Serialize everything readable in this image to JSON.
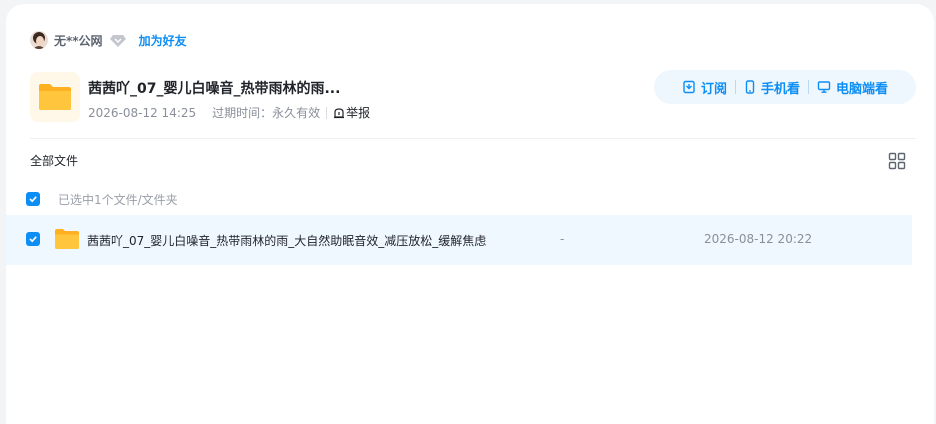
{
  "sharer": {
    "name": "无**公网",
    "add_friend_label": "加为好友"
  },
  "share": {
    "title": "茜茜吖_07_婴儿白噪音_热带雨林的雨...",
    "date": "2026-08-12 14:25",
    "expire_label": "过期时间：",
    "expire_value": "永久有效",
    "report_label": "举报"
  },
  "actions": {
    "subscribe": "订阅",
    "mobile": "手机看",
    "desktop": "电脑端看"
  },
  "list": {
    "breadcrumb": "全部文件",
    "selected_text": "已选中1个文件/文件夹",
    "rows": [
      {
        "name": "茜茜吖_07_婴儿白噪音_热带雨林的雨_大自然助眠音效_减压放松_缓解焦虑",
        "size": "-",
        "date": "2026-08-12 20:22"
      }
    ]
  },
  "colors": {
    "accent": "#0d8ef5",
    "row_highlight": "#f0f8ff",
    "folder": "#ffc53d"
  },
  "icons": {
    "avatar": "avatar-photo",
    "vip": "diamond-icon",
    "folder": "folder-icon",
    "report": "report-icon",
    "subscribe": "subscribe-icon",
    "mobile": "phone-icon",
    "desktop": "monitor-icon",
    "grid": "grid-view-icon",
    "check": "check-icon"
  }
}
